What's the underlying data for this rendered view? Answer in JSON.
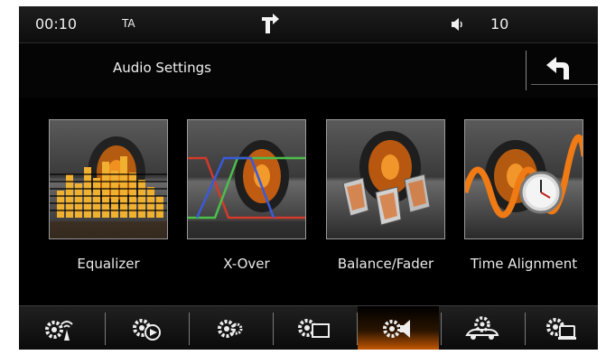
{
  "status_bar": {
    "time": "00:10",
    "ta": "TA",
    "navigation_icon": "turn-right-arrow-icon",
    "volume_icon": "speaker-icon",
    "volume": "10"
  },
  "header": {
    "title": "Audio Settings",
    "back_icon": "back-arrow-icon"
  },
  "tiles": [
    {
      "label": "Equalizer",
      "icon": "equalizer-speaker-icon"
    },
    {
      "label": "X-Over",
      "icon": "crossover-speaker-icon"
    },
    {
      "label": "Balance/Fader",
      "icon": "balance-fader-seats-icon"
    },
    {
      "label": "Time Alignment",
      "icon": "time-alignment-clock-icon"
    }
  ],
  "bottom_bar": {
    "active_index": 4,
    "items": [
      {
        "icon": "radio-settings-icon"
      },
      {
        "icon": "media-settings-icon"
      },
      {
        "icon": "general-settings-icon"
      },
      {
        "icon": "display-settings-icon"
      },
      {
        "icon": "audio-settings-icon"
      },
      {
        "icon": "vehicle-settings-icon"
      },
      {
        "icon": "system-settings-icon"
      }
    ]
  },
  "colors": {
    "accent": "#e87a10",
    "background": "#000000",
    "text": "#e8e8e8"
  }
}
